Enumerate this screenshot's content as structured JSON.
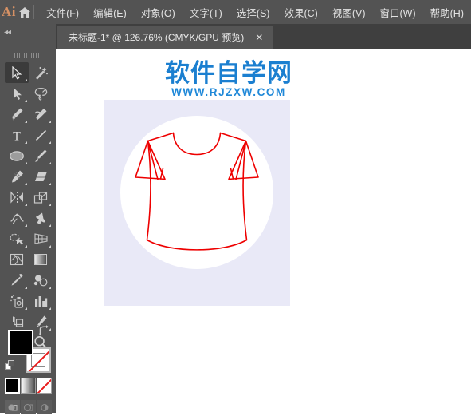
{
  "app": {
    "name": "Adobe Illustrator",
    "logo_text": "Ai",
    "home_icon": "home-icon"
  },
  "menubar": {
    "items": [
      {
        "label": "文件(F)",
        "name": "menu-file"
      },
      {
        "label": "编辑(E)",
        "name": "menu-edit"
      },
      {
        "label": "对象(O)",
        "name": "menu-object"
      },
      {
        "label": "文字(T)",
        "name": "menu-type"
      },
      {
        "label": "选择(S)",
        "name": "menu-select"
      },
      {
        "label": "效果(C)",
        "name": "menu-effect"
      },
      {
        "label": "视图(V)",
        "name": "menu-view"
      },
      {
        "label": "窗口(W)",
        "name": "menu-window"
      },
      {
        "label": "帮助(H)",
        "name": "menu-help"
      }
    ]
  },
  "tabbar": {
    "collapse_label": "◂◂",
    "document": {
      "title": "未标题-1* @ 126.76% (CMYK/GPU 预览)",
      "name": "未标题-1",
      "modified": true,
      "zoom": "126.76%",
      "color_mode": "CMYK",
      "preview_mode": "GPU 预览",
      "close_label": "✕"
    }
  },
  "toolbar": {
    "tools": [
      {
        "name": "selection-tool",
        "label": "选择工具",
        "active": true,
        "corner": true
      },
      {
        "name": "magic-wand-tool",
        "label": "魔棒工具",
        "active": false,
        "corner": false
      },
      {
        "name": "direct-selection-tool",
        "label": "直接选择工具",
        "active": false,
        "corner": true
      },
      {
        "name": "lasso-tool",
        "label": "套索工具",
        "active": false,
        "corner": false
      },
      {
        "name": "pen-tool",
        "label": "钢笔工具",
        "active": false,
        "corner": true
      },
      {
        "name": "curvature-tool",
        "label": "曲率工具",
        "active": false,
        "corner": true
      },
      {
        "name": "type-tool",
        "label": "文字工具",
        "active": false,
        "corner": true
      },
      {
        "name": "line-segment-tool",
        "label": "直线段工具",
        "active": false,
        "corner": true
      },
      {
        "name": "ellipse-tool",
        "label": "椭圆工具",
        "active": false,
        "corner": true
      },
      {
        "name": "paintbrush-tool",
        "label": "画笔工具",
        "active": false,
        "corner": true
      },
      {
        "name": "blob-brush-tool",
        "label": "斑点画笔工具",
        "active": false,
        "corner": true
      },
      {
        "name": "eraser-tool",
        "label": "橡皮擦工具",
        "active": false,
        "corner": true
      },
      {
        "name": "rotate-tool",
        "label": "旋转工具",
        "active": false,
        "corner": true
      },
      {
        "name": "scale-tool",
        "label": "比例缩放工具",
        "active": false,
        "corner": true
      },
      {
        "name": "width-tool",
        "label": "宽度工具",
        "active": false,
        "corner": true
      },
      {
        "name": "free-transform-tool",
        "label": "自由变换工具",
        "active": false,
        "corner": true
      },
      {
        "name": "shape-builder-tool",
        "label": "形状生成器工具",
        "active": false,
        "corner": true
      },
      {
        "name": "perspective-grid-tool",
        "label": "透视网格工具",
        "active": false,
        "corner": true
      },
      {
        "name": "mesh-tool",
        "label": "网格工具",
        "active": false,
        "corner": false
      },
      {
        "name": "gradient-tool",
        "label": "渐变工具",
        "active": false,
        "corner": false
      },
      {
        "name": "eyedropper-tool",
        "label": "吸管工具",
        "active": false,
        "corner": true
      },
      {
        "name": "blend-tool",
        "label": "混合工具",
        "active": false,
        "corner": true
      },
      {
        "name": "symbol-sprayer-tool",
        "label": "符号喷枪工具",
        "active": false,
        "corner": true
      },
      {
        "name": "column-graph-tool",
        "label": "柱形图工具",
        "active": false,
        "corner": true
      },
      {
        "name": "artboard-tool",
        "label": "画板工具",
        "active": false,
        "corner": false
      },
      {
        "name": "slice-tool",
        "label": "切片工具",
        "active": false,
        "corner": true
      },
      {
        "name": "hand-tool",
        "label": "抓手工具",
        "active": false,
        "corner": true
      },
      {
        "name": "zoom-tool",
        "label": "缩放工具",
        "active": false,
        "corner": false
      }
    ],
    "color_controls": {
      "fill_label": "填色",
      "fill_color": "#000000",
      "stroke_label": "描边",
      "stroke_color": "无",
      "swap_label": "互换填色和描边",
      "default_label": "默认填色和描边",
      "modes": [
        {
          "name": "color-mode-swatch",
          "label": "颜色"
        },
        {
          "name": "gradient-mode-swatch",
          "label": "渐变"
        },
        {
          "name": "none-mode-swatch",
          "label": "无"
        }
      ],
      "draw_modes": [
        {
          "name": "draw-normal-button",
          "label": "正常绘图",
          "selected": true
        },
        {
          "name": "draw-behind-button",
          "label": "背面绘图",
          "selected": false
        },
        {
          "name": "draw-inside-button",
          "label": "内部绘图",
          "selected": false
        }
      ]
    }
  },
  "canvas": {
    "watermark": {
      "cn": "软件自学网",
      "en": "WWW.RJZXW.COM",
      "color": "#1b7fd0"
    },
    "artboard": {
      "background_color": "#e9e9f7",
      "circle_color": "#ffffff",
      "artwork_name": "t-shirt-outline",
      "artwork_label": "红色线稿女式T恤",
      "stroke_color": "#ee0000"
    }
  }
}
